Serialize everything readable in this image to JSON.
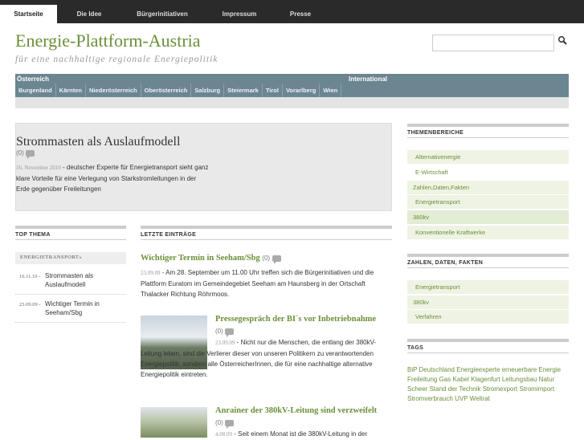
{
  "nav": {
    "tabs": [
      "Startseite",
      "Die Idee",
      "Bürgerinitiativen",
      "Impressum",
      "Presse"
    ]
  },
  "site": {
    "title": "Energie-Plattform-Austria",
    "subtitle": "für eine nachhaltige regionale Energiepolitik"
  },
  "regions": {
    "heading_left": "Österreich",
    "heading_right": "International",
    "links": [
      "Burgenland",
      "Kärnten",
      "Niederösterreich",
      "Oberösterreich",
      "Salzburg",
      "Steiermark",
      "Tirol",
      "Vorarlberg",
      "Wien"
    ]
  },
  "featured": {
    "title": "Strommasten als Auslaufmodell",
    "comments": "(0)",
    "date": "16. November 2010",
    "text": "- deutscher Experte für Energietransport sieht ganz klare Vorteile für eine Verlegung von Starkstromleitungen in der Erde gegenüber Freileitungen"
  },
  "top_thema": {
    "heading": "TOP THEMA",
    "sub": "ENERGIETRANSPORT»",
    "items": [
      {
        "date": "16.11.10 -",
        "title": "Strommasten als Auslaufmodell"
      },
      {
        "date": "23.09.09 -",
        "title": "Wichtiger Termin in Seeham/Sbg"
      }
    ]
  },
  "latest": {
    "heading": "LETZTE EINTRÄGE",
    "posts": [
      {
        "title": "Wichtiger Termin in Seeham/Sbg",
        "comments": "(0)",
        "date": "23.09.09",
        "text": "- Am 28. September um 11.00 Uhr treffen sich die Bürgerinitiativen und die Plattform Euratom im Gemeindegebiet Seeham am Haunsberg in der Ortschaft Thalacker Richtung Röhrmoos."
      },
      {
        "title": "Pressegespräch der BI´s vor Inbetriebnahme",
        "comments": "(0)",
        "date": "23.09.09",
        "text": "- Nicht nur die Menschen, die entlang der 380kV-Leitung leben, sind die Verlierer dieser von unseren Politikern zu verantwortenden Energiepolitik, sondern alle ÖsterreicherInnen, die für eine nachhaltige alternative Energiepolitik eintreten."
      },
      {
        "title": "Anrainer der 380kV-Leitung sind verzweifelt",
        "comments": "(0)",
        "date": "4.08.09",
        "text": "- Seit einem Monat ist die 380kV-Leitung in der"
      }
    ]
  },
  "themen": {
    "heading": "THEMENBEREICHE",
    "items": [
      "Alternativenergie",
      "E-Wirtschaft",
      "Zahlen,Daten,Fakten",
      "Energietransport",
      "380kv",
      "Konventionelle Kraftwerke"
    ]
  },
  "zdf": {
    "heading": "ZAHLEN, DATEN, FAKTEN",
    "items": [
      "Energietransport",
      "380kv",
      "Verfahren"
    ]
  },
  "tags": {
    "heading": "TAGS",
    "text": "BiP Deutschland Energieexperte erneuerbare Energie Freileitung Gas Kabel Klagenfurt Leitungsbau Natur Scheer Stand der Technik Stromexport Stromimport Stromverbrauch UVP Weltrat"
  },
  "colors": {
    "accent": "#6b8f3a",
    "regionbar": "#6b8690",
    "topnav": "#2a2a2a"
  }
}
